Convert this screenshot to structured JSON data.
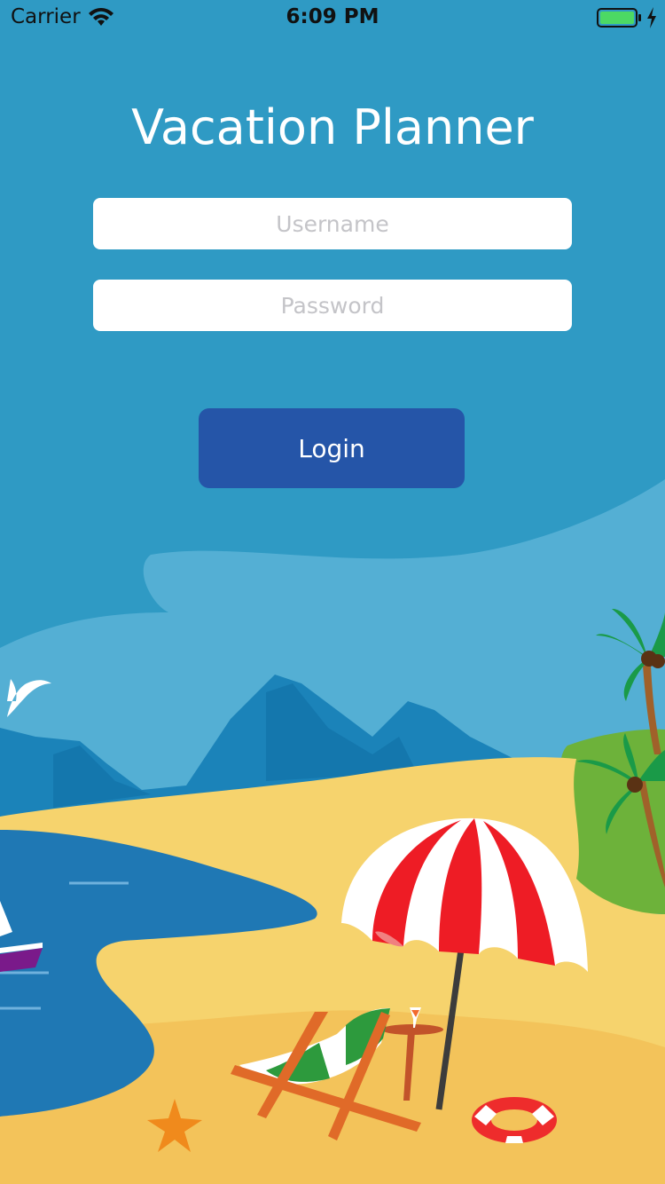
{
  "status_bar": {
    "carrier": "Carrier",
    "time": "6:09 PM",
    "battery_color": "#4cd964"
  },
  "app_title": "Vacation Planner",
  "form": {
    "username_placeholder": "Username",
    "password_placeholder": "Password",
    "login_label": "Login"
  },
  "colors": {
    "sky": "#2f9ac4",
    "button": "#2555a8",
    "sand": "#f6d36d",
    "sea": "#1f78b4",
    "umbrella_red": "#ee1c25"
  },
  "icons": [
    "wifi-icon",
    "battery-icon",
    "charging-icon",
    "seagull-icon",
    "starfish-icon",
    "lifebuoy-icon",
    "palm-tree-icon",
    "umbrella-icon",
    "beach-chair-icon",
    "sailboat-icon"
  ]
}
